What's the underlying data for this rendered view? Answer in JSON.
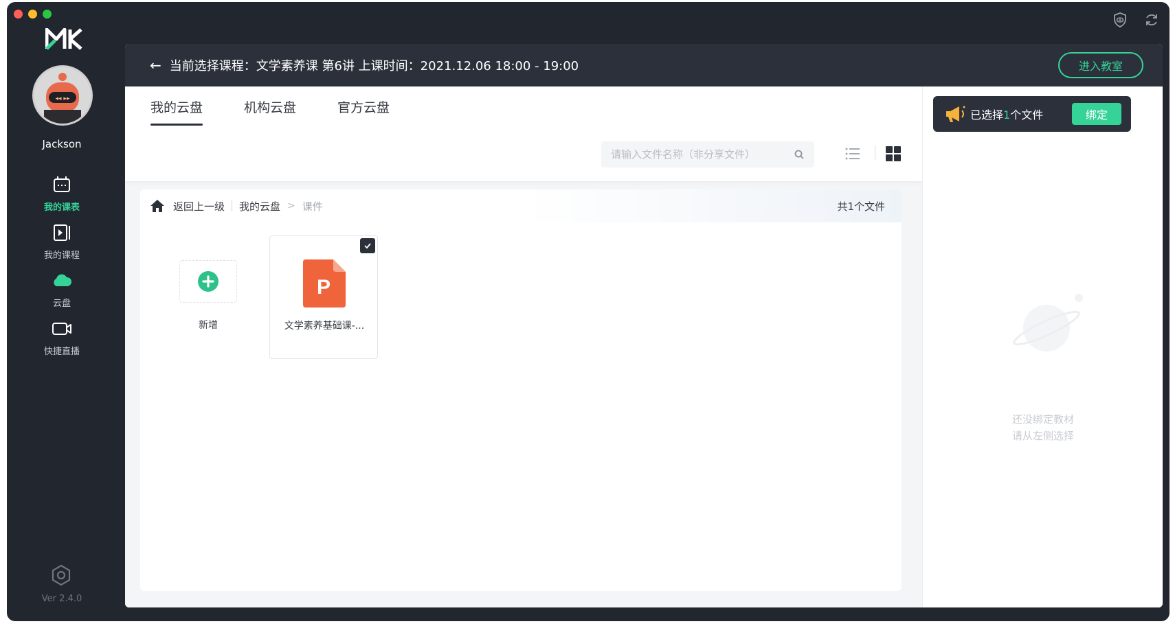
{
  "window": {
    "traffic_lights": [
      "close",
      "minimize",
      "maximize"
    ],
    "top_icons": [
      "shield-eye-icon",
      "refresh-icon"
    ]
  },
  "sidebar": {
    "logo": "MK",
    "username": "Jackson",
    "items": [
      {
        "label": "我的课表",
        "icon": "calendar-icon",
        "active": true
      },
      {
        "label": "我的课程",
        "icon": "video-course-icon",
        "active": false
      },
      {
        "label": "云盘",
        "icon": "cloud-icon",
        "active": false
      },
      {
        "label": "快捷直播",
        "icon": "camera-icon",
        "active": false
      }
    ],
    "version": "Ver 2.4.0"
  },
  "header": {
    "text": "当前选择课程：文学素养课 第6讲  上课时间：2021.12.06 18:00 - 19:00",
    "enter_button": "进入教室"
  },
  "tabs": [
    {
      "label": "我的云盘",
      "active": true
    },
    {
      "label": "机构云盘",
      "active": false
    },
    {
      "label": "官方云盘",
      "active": false
    }
  ],
  "search": {
    "placeholder": "请输入文件名称（非分享文件）"
  },
  "breadcrumb": {
    "back": "返回上一级",
    "root": "我的云盘",
    "separator": ">",
    "current": "课件",
    "count": "共1个文件"
  },
  "files": {
    "new_label": "新增",
    "items": [
      {
        "name": "文学素养基础课-...",
        "type": "ppt",
        "icon_letter": "P",
        "checked": true
      }
    ]
  },
  "right_panel": {
    "selected_prefix": "已选择",
    "selected_count": "1",
    "selected_suffix": "个文件",
    "bind_button": "绑定",
    "empty_line1": "还没绑定教材",
    "empty_line2": "请从左侧选择"
  },
  "colors": {
    "accent": "#36d399",
    "dark": "#2b303b",
    "sidebar_bg": "#22262f",
    "ppt": "#f0643c"
  }
}
